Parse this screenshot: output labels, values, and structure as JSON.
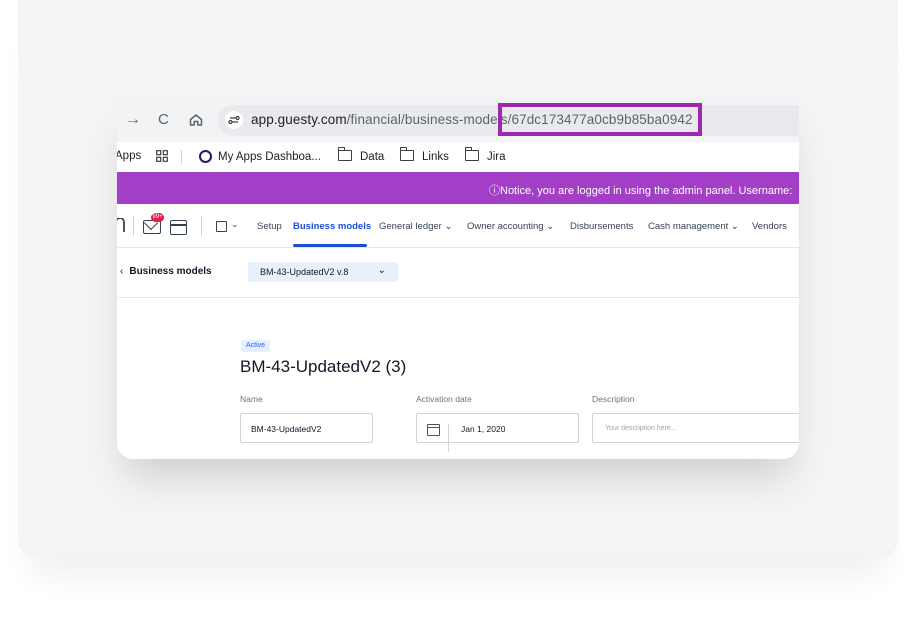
{
  "browser": {
    "nav_forward": "→",
    "nav_reload": "C",
    "url_host": "app.guesty.com",
    "url_path": "/financial/business-models/67dc173477a0cb9b85ba0942"
  },
  "bookmarks": {
    "apps": "Apps",
    "items": [
      {
        "label": "My Apps Dashboa...",
        "icon": "okta-icon"
      },
      {
        "label": "Data",
        "icon": "folder-icon"
      },
      {
        "label": "Links",
        "icon": "folder-icon"
      },
      {
        "label": "Jira",
        "icon": "folder-icon"
      }
    ]
  },
  "notice": {
    "text": "ⓘNotice, you are logged in using the admin panel.   Username:"
  },
  "nav": {
    "badge": "99+",
    "items": [
      "Setup",
      "Business models",
      "General ledger ⌄",
      "Owner accounting ⌄",
      "Disbursements",
      "Cash management ⌄",
      "Vendors"
    ],
    "active": "Business models"
  },
  "subheader": {
    "back_label": "Business models",
    "version": "BM-43-UpdatedV2 v.8"
  },
  "model": {
    "status": "Active",
    "title": "BM-43-UpdatedV2 (3)",
    "name_label": "Name",
    "name_value": "BM-43-UpdatedV2",
    "activation_label": "Activation date",
    "activation_value": "Jan 1, 2020",
    "description_label": "Description",
    "description_placeholder": "Your description here..."
  },
  "colors": {
    "notice_bar": "#a33ec6",
    "highlight_border": "#9c27b0",
    "active_nav": "#1d4ed8"
  }
}
